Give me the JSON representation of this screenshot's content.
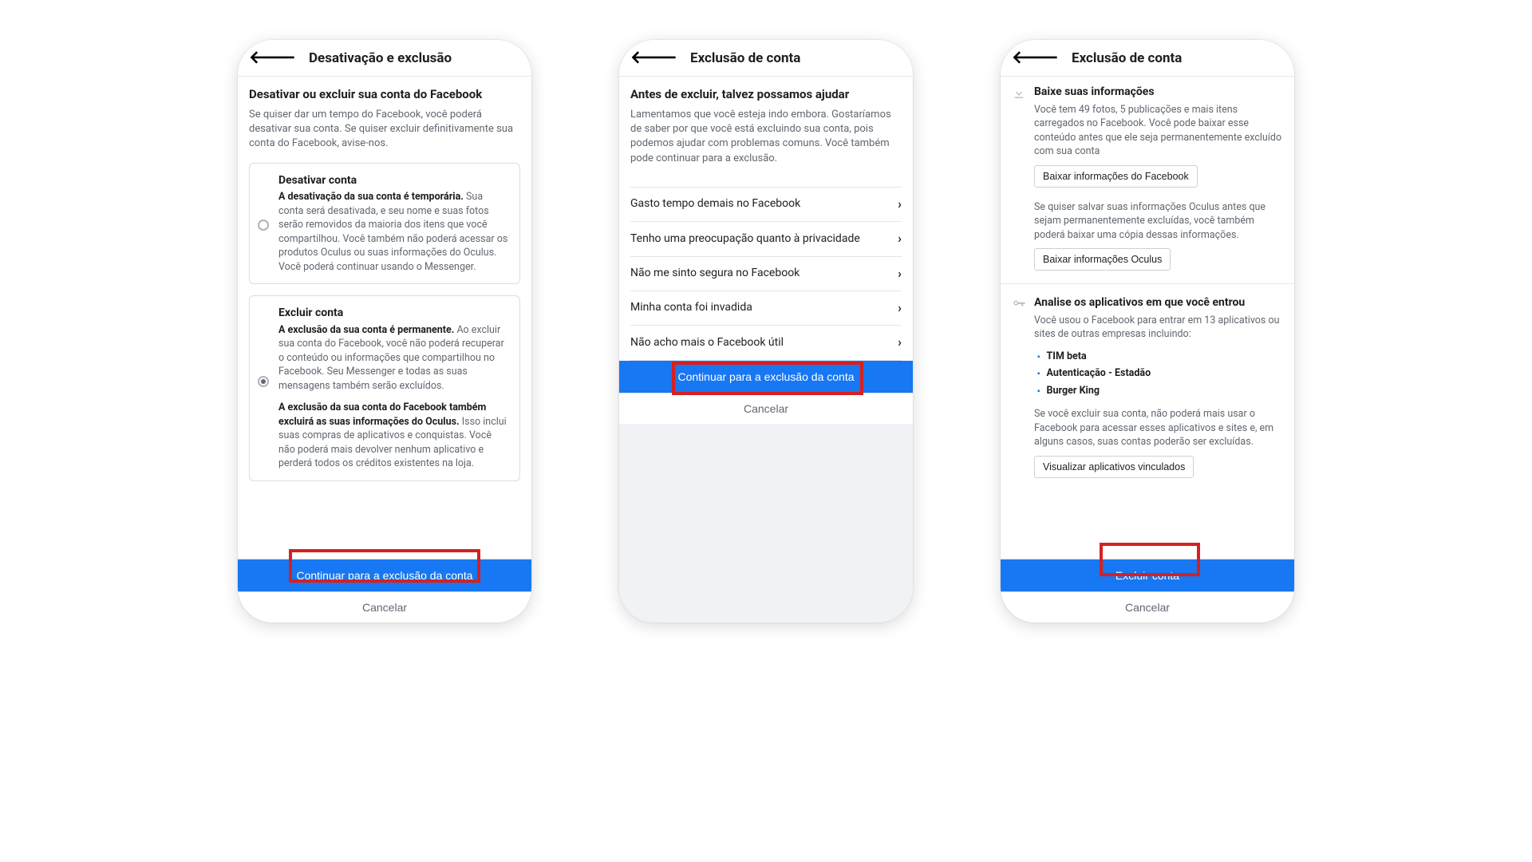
{
  "screen1": {
    "header_title": "Desativação e exclusão",
    "main_heading": "Desativar ou excluir sua conta do Facebook",
    "main_desc": "Se quiser dar um tempo do Facebook, você poderá desativar sua conta. Se quiser excluir definitivamente sua conta do Facebook, avise-nos.",
    "opt1_title": "Desativar conta",
    "opt1_bold": "A desativação da sua conta é temporária.",
    "opt1_rest": " Sua conta será desativada, e seu nome e suas fotos serão removidos da maioria dos itens que você compartilhou. Você também não poderá acessar os produtos Oculus ou suas informações do Oculus. Você poderá continuar usando o Messenger.",
    "opt2_title": "Excluir conta",
    "opt2_p1_bold": "A exclusão da sua conta é permanente.",
    "opt2_p1_rest": " Ao excluir sua conta do Facebook, você não poderá recuperar o conteúdo ou informações que compartilhou no Facebook. Seu Messenger e todas as suas mensagens também serão excluídos.",
    "opt2_p2_bold": "A exclusão da sua conta do Facebook também excluirá as suas informações do Oculus.",
    "opt2_p2_rest": " Isso inclui suas compras de aplicativos e conquistas. Você não poderá mais devolver nenhum aplicativo e perderá todos os créditos existentes na loja.",
    "primary_btn": "Continuar para a exclusão da conta",
    "cancel_btn": "Cancelar"
  },
  "screen2": {
    "header_title": "Exclusão de conta",
    "main_heading": "Antes de excluir, talvez possamos ajudar",
    "main_desc": "Lamentamos que você esteja indo embora. Gostaríamos de saber por que você está excluindo sua conta, pois podemos ajudar com problemas comuns. Você também pode continuar para a exclusão.",
    "reasons": [
      "Gasto tempo demais no Facebook",
      "Tenho uma preocupação quanto à privacidade",
      "Não me sinto segura no Facebook",
      "Minha conta foi invadida",
      "Não acho mais o Facebook útil"
    ],
    "primary_btn": "Continuar para a exclusão da conta",
    "cancel_btn": "Cancelar"
  },
  "screen3": {
    "header_title": "Exclusão de conta",
    "download_title": "Baixe suas informações",
    "download_desc": "Você tem 49 fotos, 5 publicações e mais itens carregados no Facebook. Você pode baixar esse conteúdo antes que ele seja permanentemente excluído com sua conta",
    "download_fb_btn": "Baixar informações do Facebook",
    "oculus_desc": "Se quiser salvar suas informações Oculus antes que sejam permanentemente excluídas, você também poderá baixar uma cópia dessas informações.",
    "download_oculus_btn": "Baixar informações Oculus",
    "apps_title": "Analise os aplicativos em que você entrou",
    "apps_desc": "Você usou o Facebook para entrar em 13 aplicativos ou sites de outras empresas incluindo:",
    "apps_list": [
      "TIM beta",
      "Autenticação - Estadão",
      "Burger King"
    ],
    "apps_warning": "Se você excluir sua conta, não poderá mais usar o Facebook para acessar esses aplicativos e sites e, em alguns casos, suas contas poderão ser excluídas.",
    "apps_view_btn": "Visualizar aplicativos vinculados",
    "primary_btn": "Excluir conta",
    "cancel_btn": "Cancelar"
  }
}
